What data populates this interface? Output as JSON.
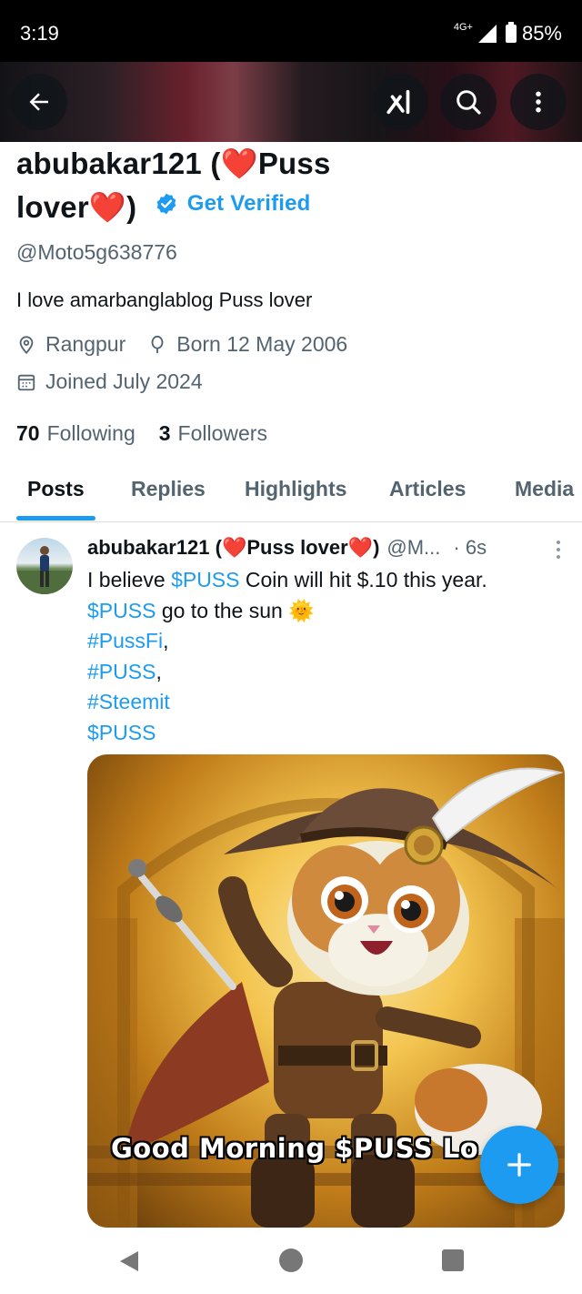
{
  "status_bar": {
    "time": "3:19",
    "network": "4G+",
    "battery": "85%"
  },
  "header": {
    "back_icon": "arrow-left-icon",
    "grok_icon": "grok-icon",
    "search_icon": "search-icon",
    "more_icon": "more-vertical-icon"
  },
  "profile": {
    "name_part1": "abubakar121 (",
    "name_heart": "❤️",
    "name_part2": "Puss",
    "name_part3": "lover",
    "name_part4": ")",
    "get_verified": "Get Verified",
    "handle": "@Moto5g638776",
    "bio": "I love amarbanglablog  Puss lover",
    "location": "Rangpur",
    "birthday": "Born 12 May 2006",
    "joined": "Joined July 2024",
    "following_count": "70",
    "following_label": "Following",
    "followers_count": "3",
    "followers_label": "Followers"
  },
  "tabs": [
    {
      "label": "Posts",
      "active": true
    },
    {
      "label": "Replies"
    },
    {
      "label": "Highlights"
    },
    {
      "label": "Articles"
    },
    {
      "label": "Media"
    }
  ],
  "tweet": {
    "name_part1": "abubakar121 (",
    "name_part2": "Puss lover",
    "name_part3": ")",
    "handle": "@M...",
    "time": "· 6s",
    "line1_pre": "I believe ",
    "line1_tag": "$PUSS",
    "line1_post": " Coin will hit $.10 this year.",
    "line2_tag": "$PUSS",
    "line2_post": " go to the sun 🌞",
    "line3_tag": "#PussFi",
    "line3_post": ",",
    "line4_tag": "#PUSS",
    "line4_post": ",",
    "line5_tag": "#Steemit",
    "line6_tag": "$PUSS",
    "media_caption": "Good Morning $PUSS Lo"
  },
  "colors": {
    "accent": "#1d9bf0",
    "text": "#0f1419",
    "muted": "#536471",
    "heart": "#e0171b"
  }
}
